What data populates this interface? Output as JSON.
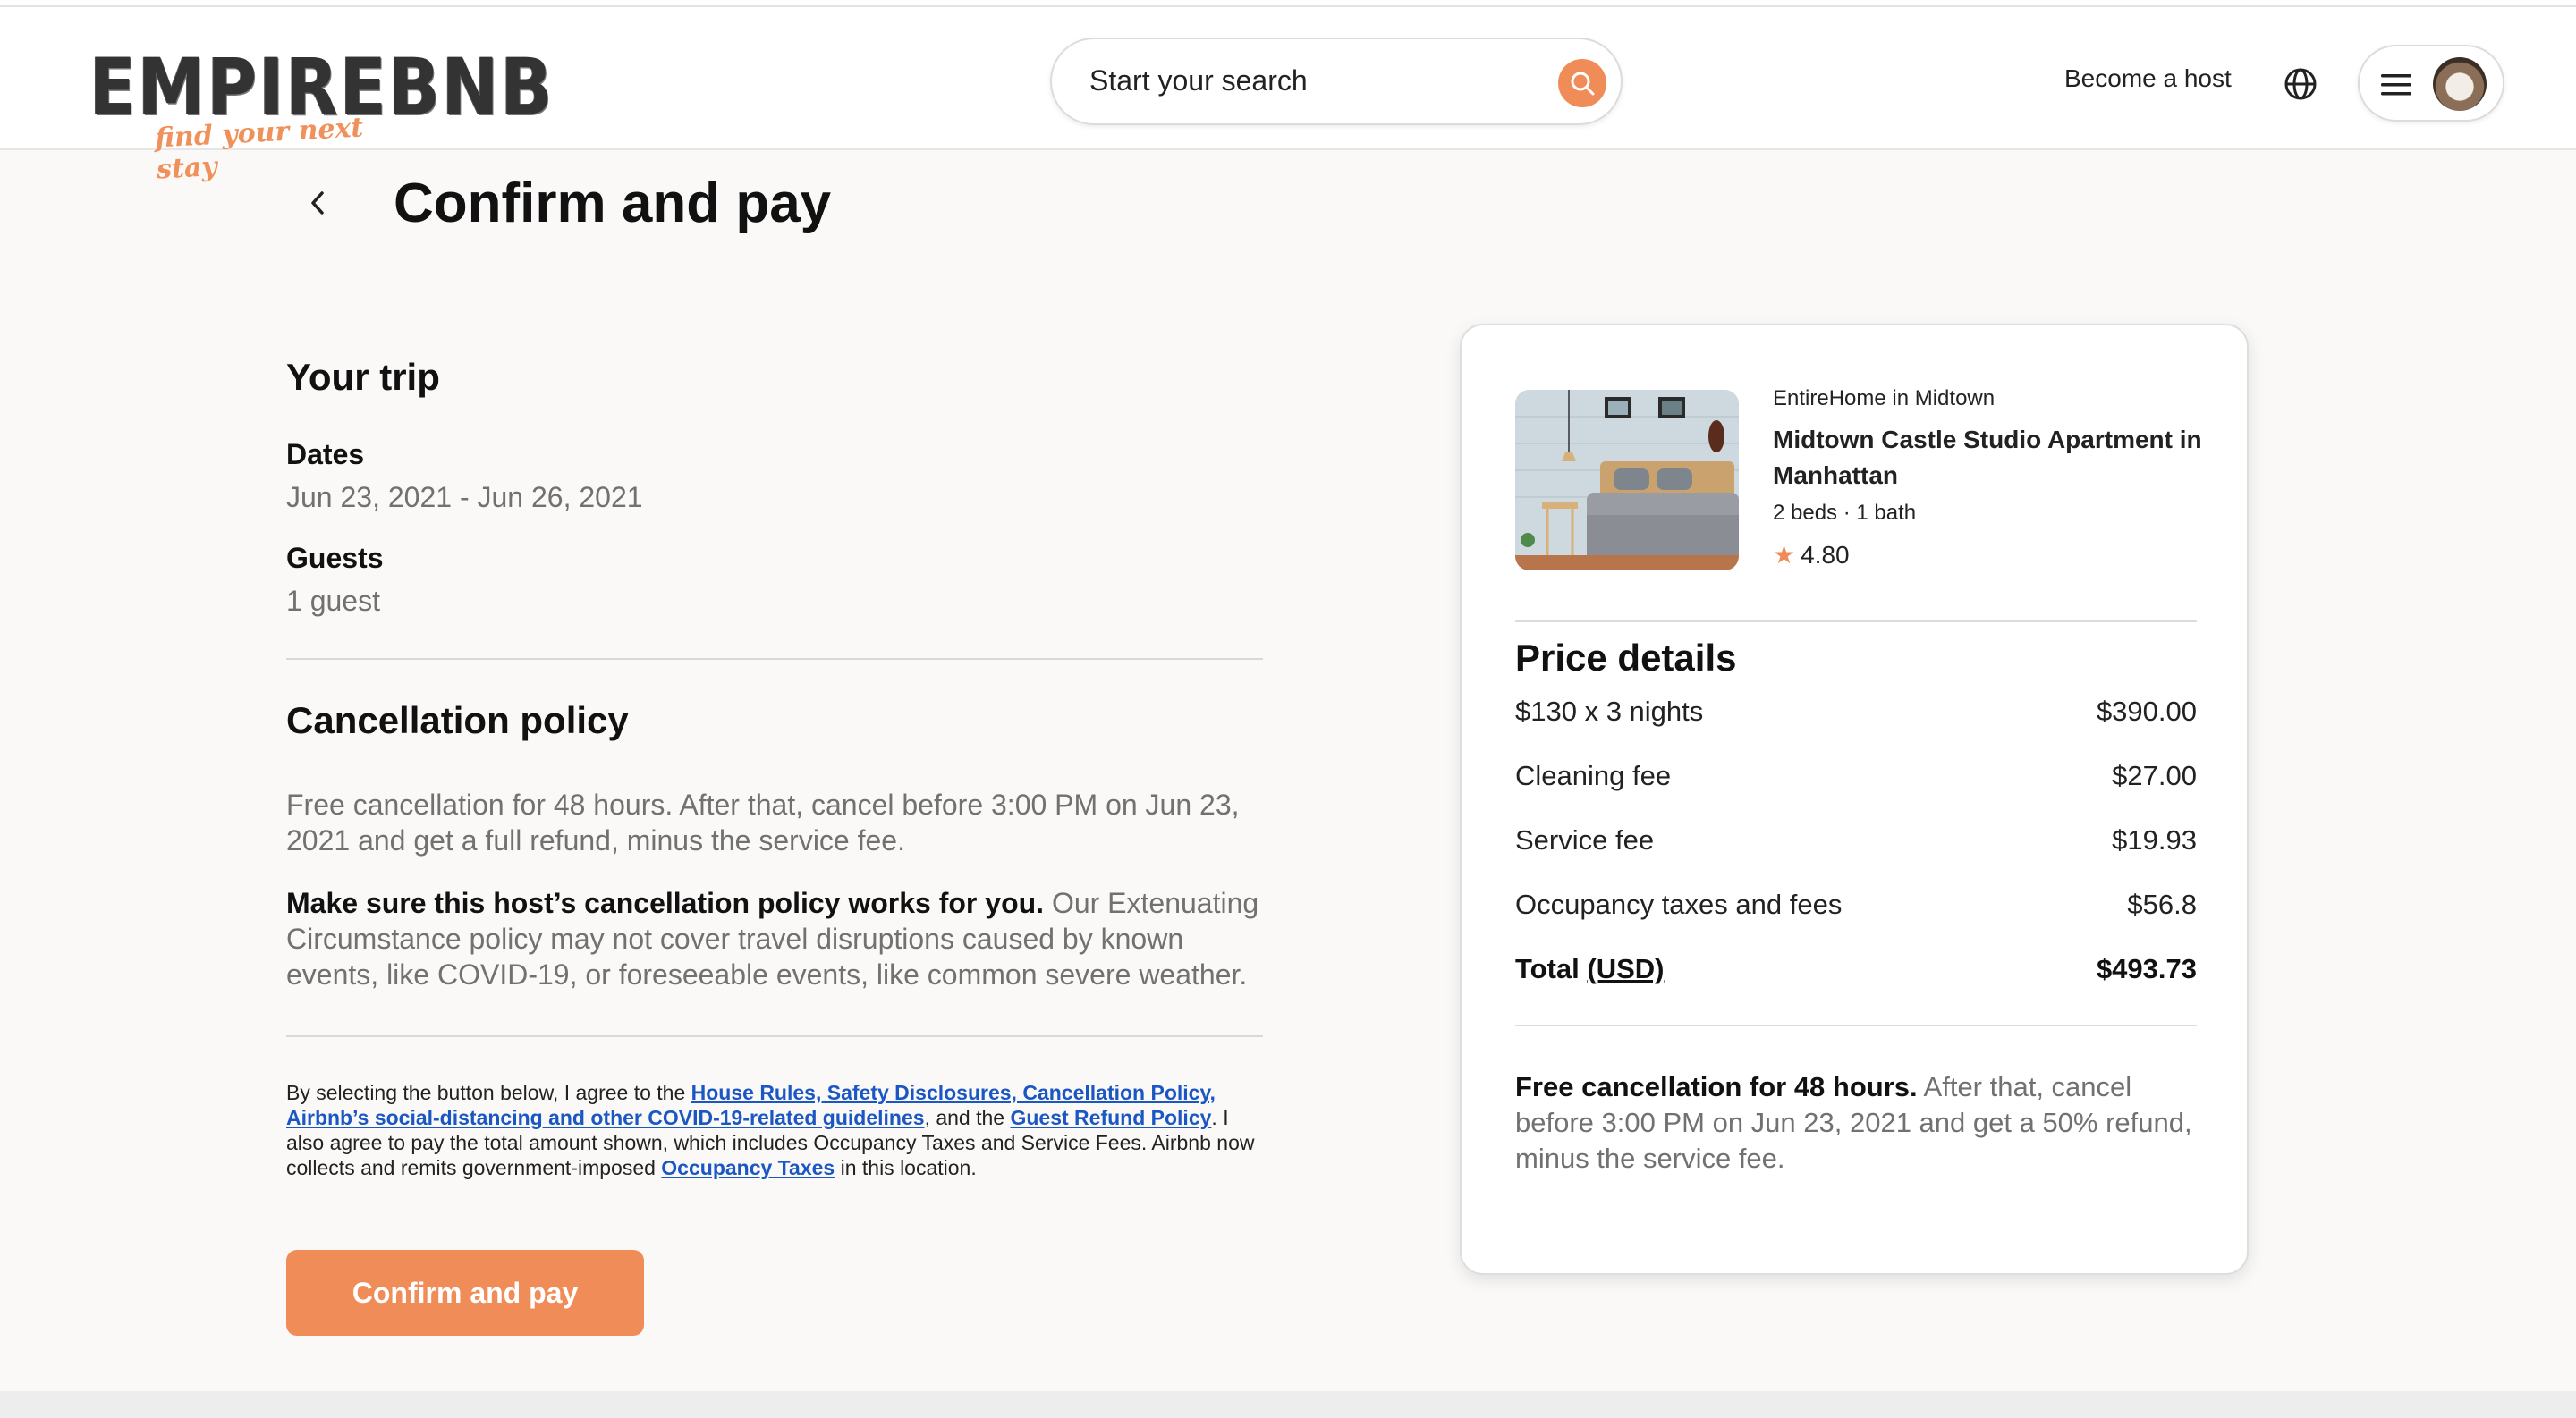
{
  "brand": {
    "name": "EMPIREBNB",
    "tagline": "find your next stay",
    "accent_color": "#f08c57"
  },
  "header": {
    "search_placeholder": "Start your search",
    "search_icon": "search-icon",
    "become_host": "Become a host",
    "globe_icon": "globe-icon",
    "menu_icon": "hamburger-icon"
  },
  "page": {
    "title": "Confirm and pay",
    "back_icon": "chevron-left-icon"
  },
  "trip": {
    "heading": "Your trip",
    "dates_label": "Dates",
    "dates_value": "Jun 23, 2021 - Jun 26, 2021",
    "guests_label": "Guests",
    "guests_value": "1 guest"
  },
  "cancellation": {
    "heading": "Cancellation policy",
    "text": "Free cancellation for 48 hours. After that, cancel before 3:00 PM on Jun 23, 2021 and get a full refund, minus the service fee.",
    "warning_bold": "Make sure this host’s cancellation policy works for you.",
    "warning_text": " Our Extenuating Circumstance policy may not cover travel disruptions caused by known events, like COVID-19, or foreseeable events, like common severe weather."
  },
  "legal": {
    "intro": "By selecting the button below, I agree to the ",
    "link1": "House Rules, Safety Disclosures, Cancellation Policy, Airbnb’s social-distancing and other COVID-19-related guidelines",
    "mid1": ", and the ",
    "link2": "Guest Refund Policy",
    "mid2": ". I also agree to pay the total amount shown, which includes Occupancy Taxes and Service Fees. Airbnb now collects and remits government-imposed ",
    "link3": "Occupancy Taxes",
    "outro": " in this location."
  },
  "confirm_button": "Confirm and pay",
  "listing": {
    "type": "EntireHome in Midtown",
    "name": "Midtown Castle Studio Apartment in Manhattan",
    "beds_baths": "2 beds · 1 bath",
    "rating": "4.80",
    "star_icon": "star-icon"
  },
  "price": {
    "heading": "Price details",
    "rows": [
      {
        "label": "$130 x 3 nights",
        "amount": "$390.00"
      },
      {
        "label": "Cleaning fee",
        "amount": "$27.00"
      },
      {
        "label": "Service fee",
        "amount": "$19.93"
      },
      {
        "label": "Occupancy taxes and fees",
        "amount": "$56.8"
      }
    ],
    "total_label": "Total",
    "total_currency": "(USD)",
    "total_amount": "$493.73"
  },
  "card_cancellation": {
    "bold": "Free cancellation for 48 hours.",
    "text": " After that, cancel before 3:00 PM on Jun 23, 2021 and get a 50% refund, minus the service fee."
  }
}
